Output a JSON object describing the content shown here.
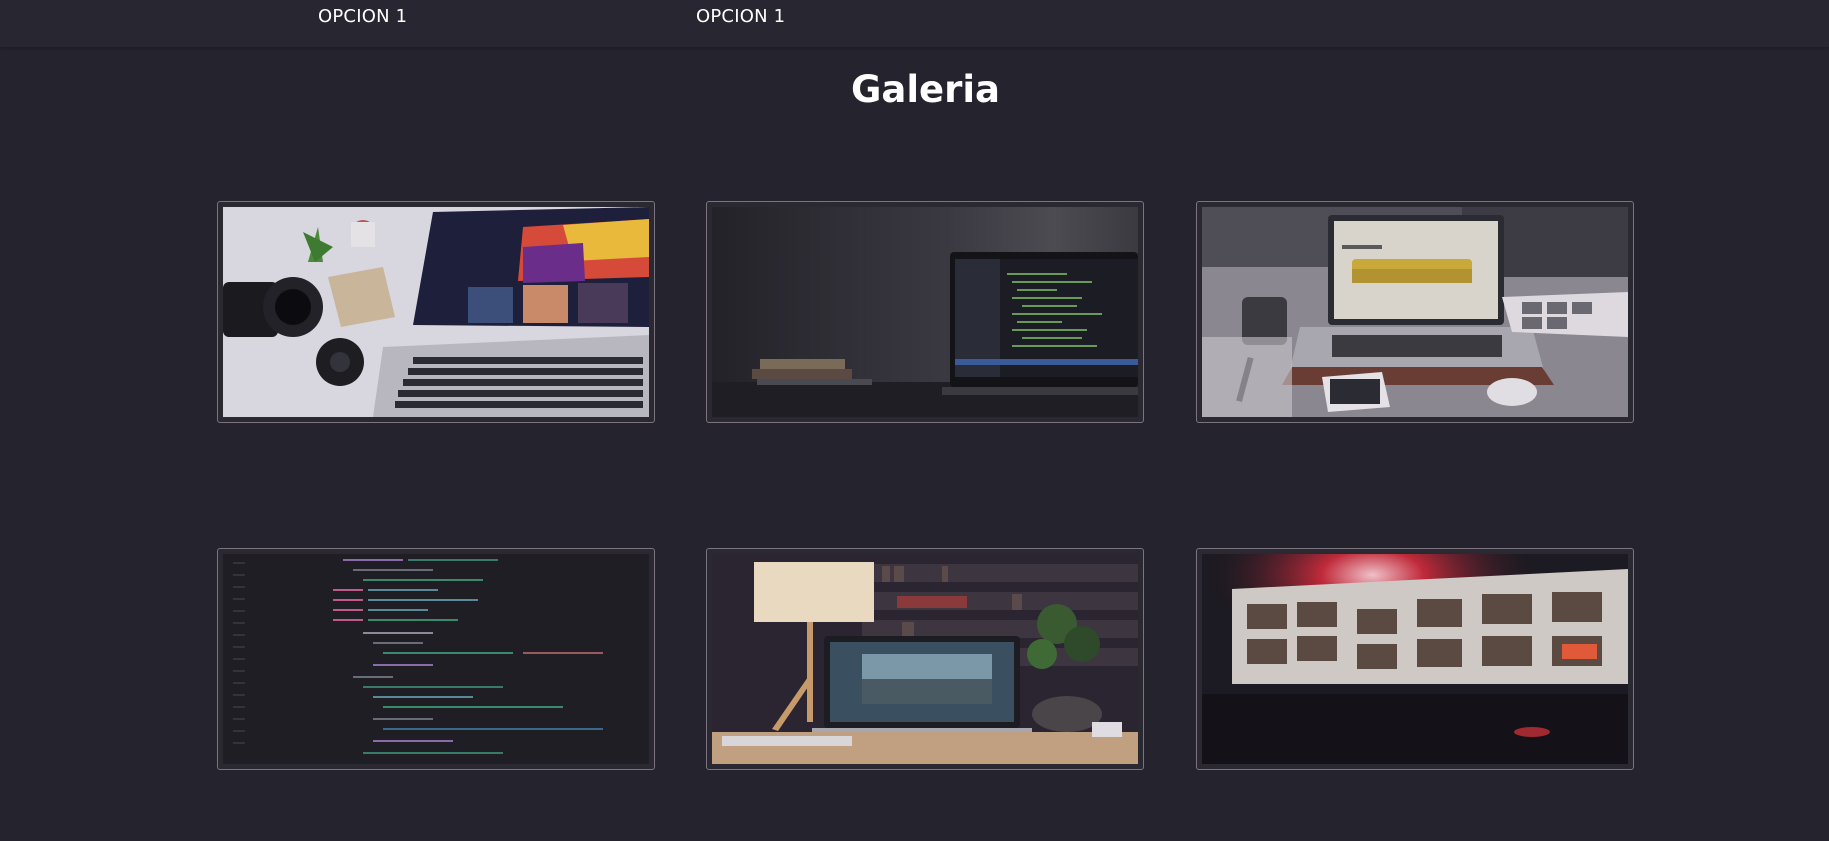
{
  "nav": {
    "items": [
      {
        "label": "OPCION 1"
      },
      {
        "label": "OPCION 1"
      }
    ]
  },
  "page": {
    "title": "Galeria"
  },
  "gallery": {
    "images": [
      {
        "subject": "laptop-camera-desk-photo"
      },
      {
        "subject": "laptop-code-dark-wall-photo"
      },
      {
        "subject": "laptop-product-page-desk-photo"
      },
      {
        "subject": "code-editor-screen-photo"
      },
      {
        "subject": "laptop-lamp-bookshelf-photo"
      },
      {
        "subject": "monitor-website-red-light-photo"
      }
    ]
  },
  "colors": {
    "background": "#25232d",
    "topbar": "#282630",
    "card_border": "#7b7480",
    "text": "#ffffff"
  }
}
